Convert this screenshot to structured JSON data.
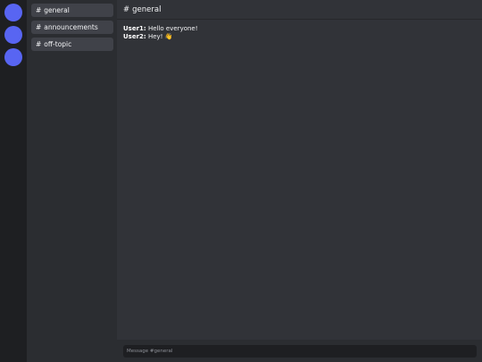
{
  "servers": [
    {
      "icon": "server-avatar"
    },
    {
      "icon": "server-avatar"
    },
    {
      "icon": "server-avatar"
    }
  ],
  "channels": [
    {
      "prefix": "#",
      "name": "general"
    },
    {
      "prefix": "#",
      "name": "announcements"
    },
    {
      "prefix": "#",
      "name": "off-topic"
    }
  ],
  "header": {
    "prefix": "#",
    "channel": "general"
  },
  "messages": [
    {
      "author": "User1:",
      "text": "Hello everyone!"
    },
    {
      "author": "User2:",
      "text": "Hey! 👋"
    }
  ],
  "composer": {
    "placeholder": "Message #general",
    "value": ""
  },
  "colors": {
    "accent": "#5865f2",
    "rail": "#1e1f22",
    "sidebar": "#2b2d31",
    "main": "#313338",
    "channel_item": "#404249"
  }
}
